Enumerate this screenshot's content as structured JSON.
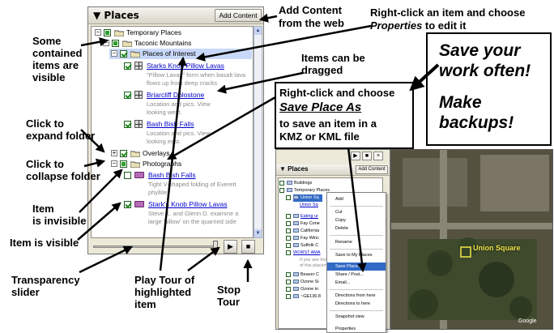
{
  "places_panel": {
    "title": "Places",
    "add_content_label": "Add Content",
    "tree": {
      "temporary_places": "Temporary Places",
      "taconic": "Taconic Mountains",
      "places_of_interest": "Places of Interest",
      "starks_link": "Starks Knob Pillow Lavas",
      "starks_desc": "\"Pillow Lavas\" form when basalt lava flows up from deep cracks",
      "briarcliff_link": "Briarcliff Dolostone",
      "briarcliff_desc": "Location and pics. View looking west.",
      "bash_bish_link": "Bash Bish Falls",
      "bash_bish_desc": "Location and pics. View looking east.",
      "overlays": "Overlays",
      "photographs": "Photographs",
      "photo_bash_link": "Bash Bish Falls",
      "photo_bash_desc": "Tight V-shaped folding of Everett phyllite.",
      "photo_stark_link": "Stark's Knob Pillow Lavas",
      "photo_stark_desc": "Steve K. and Glenn D. examine a large 'pillow' on the quarried side"
    }
  },
  "callouts": {
    "some_contained": "Some\ncontained\nitems are\nvisible",
    "click_expand": "Click to\nexpand folder",
    "click_collapse": "Click to\ncollapse folder",
    "item_invisible": "Item\nis invisible",
    "item_visible": "Item is visible",
    "transparency": "Transparency\nslider",
    "play_tour": "Play Tour of\nhighlighted\nitem",
    "stop_tour": "Stop\nTour",
    "add_content_l1": "Add Content",
    "add_content_l2": "from the web",
    "right_click_l1": "Right-click an item and choose",
    "right_click_l2": "Properties",
    "right_click_l3": " to edit it",
    "items_dragged": "Items can be\ndragged",
    "save_as_l1": "Right-click and choose",
    "save_as_l2": "Save Place As",
    "save_as_l3": "to save an item in a",
    "save_as_l4": "KMZ or KML file",
    "save_work": "Save your\nwork often!",
    "make_backups": "Make\nbackups!"
  },
  "screenshot2": {
    "title": "Places",
    "add_content_label": "Add Content",
    "rows": [
      "Buildings",
      "Temporary Places",
      "Union Sq",
      "Union Sq",
      "Eating ur",
      "Fay Cone",
      "California",
      "Fay Winc",
      "Suffolk C",
      "WORST AMA",
      "If you see hol",
      "of this placem",
      "Beaver C",
      "Ozone Si",
      "Ozone in",
      "~GE136.8"
    ],
    "context_menu": [
      "Add",
      "Cut",
      "Copy",
      "Delete",
      "Rename",
      "Save to My Places",
      "Save Place As",
      "Share / Post...",
      "Email...",
      "Directions from here",
      "Directions to here",
      "Snapshot view",
      "Properties"
    ],
    "map_label": "Union Square",
    "map_credit": "Google"
  },
  "colors": {
    "accent_blue": "#0000cc",
    "selection": "#316ac5",
    "map_label": "#f2e84a"
  }
}
